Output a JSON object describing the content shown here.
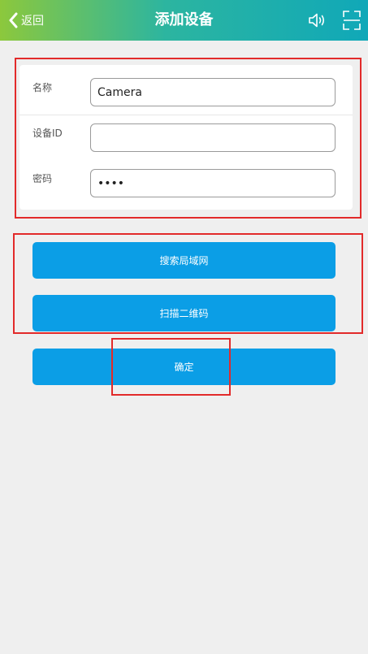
{
  "header": {
    "back_label": "返回",
    "title": "添加设备",
    "background_colors": [
      "#8cc83c",
      "#2cb5a0",
      "#10a8b8"
    ],
    "icons": [
      "chevron-left-icon",
      "speaker-icon",
      "fullscreen-icon"
    ]
  },
  "form": {
    "name_label": "名称",
    "name_value": "Camera",
    "device_id_label": "设备ID",
    "device_id_value": "",
    "password_label": "密码",
    "password_value": "••••"
  },
  "buttons": {
    "search_lan": "搜索局域网",
    "scan_qr": "扫描二维码",
    "confirm": "确定",
    "color": "#0b9ee6"
  },
  "annotations": {
    "highlight_color": "#e22a2a"
  }
}
